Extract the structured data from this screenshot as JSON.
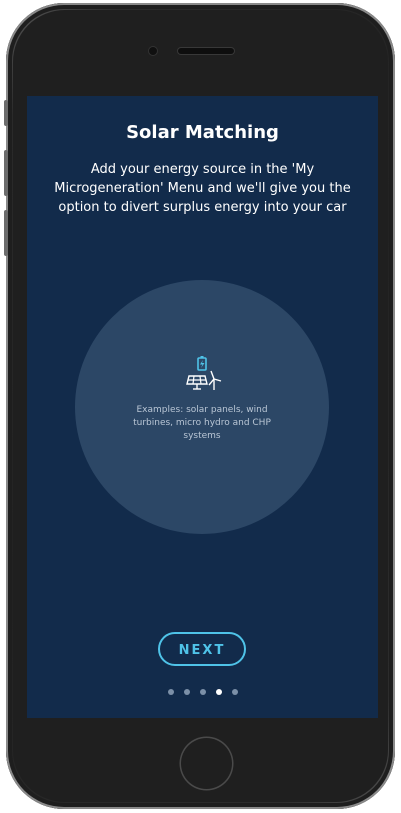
{
  "screen": {
    "title": "Solar Matching",
    "subtitle": "Add your energy source in the 'My Microgeneration' Menu and we'll give you the option to divert surplus energy into your car",
    "illustration": {
      "icon": "solar-wind-battery-icon",
      "examples_text": "Examples: solar panels, wind turbines, micro hydro and CHP systems"
    },
    "next_label": "NEXT",
    "pagination": {
      "total": 5,
      "current": 4
    }
  },
  "colors": {
    "background": "#122b4b",
    "circle": "#2c4766",
    "accent": "#4fc3e8",
    "dot_inactive": "#7c90a8",
    "dot_active": "#ffffff"
  }
}
